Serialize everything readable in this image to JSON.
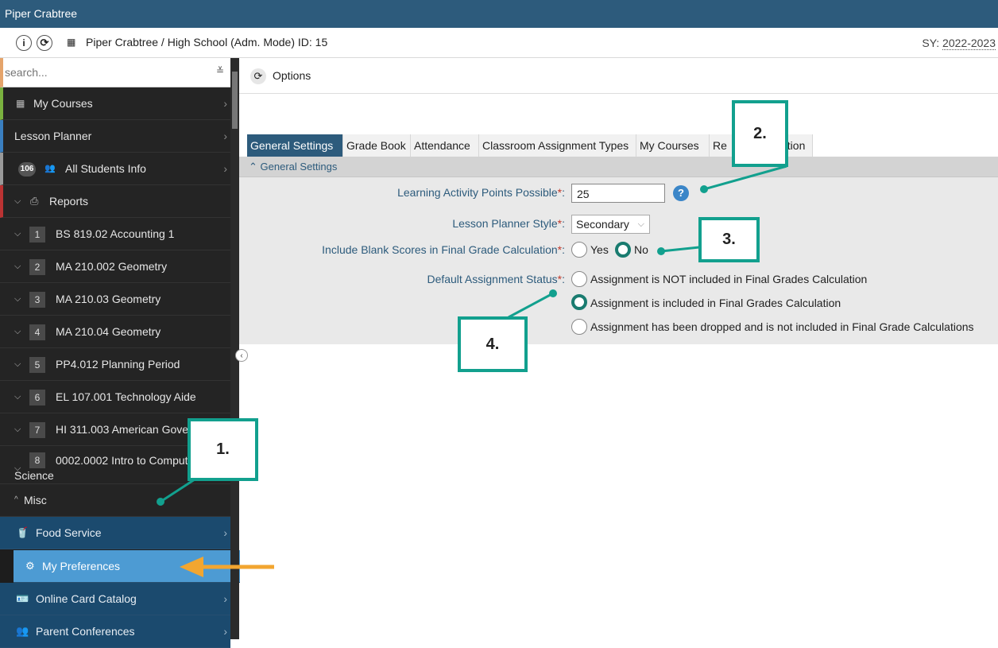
{
  "title_bar": {
    "user": "Piper Crabtree"
  },
  "info_bar": {
    "context": "Piper Crabtree / High School (Adm. Mode) ID: 15",
    "school_year_label": "SY:",
    "school_year": "2022-2023"
  },
  "sidebar": {
    "search_placeholder": "search...",
    "my_courses": "My Courses",
    "lesson_planner": "Lesson Planner",
    "students_count": "106",
    "all_students": "All Students Info",
    "reports": "Reports",
    "courses": [
      {
        "num": "1",
        "label": "BS 819.02 Accounting 1"
      },
      {
        "num": "2",
        "label": "MA 210.002 Geometry"
      },
      {
        "num": "3",
        "label": "MA 210.03 Geometry"
      },
      {
        "num": "4",
        "label": "MA 210.04 Geometry"
      },
      {
        "num": "5",
        "label": "PP4.012 Planning Period"
      },
      {
        "num": "6",
        "label": "EL 107.001 Technology Aide"
      },
      {
        "num": "7",
        "label": "HI 311.003 American Gove"
      },
      {
        "num": "8",
        "label": "0002.0002 Intro to Comput",
        "label2": "Science"
      }
    ],
    "misc": "Misc",
    "misc_items": [
      "Food Service",
      "My Preferences",
      "Online Card Catalog",
      "Parent Conferences"
    ]
  },
  "toolbar": {
    "options_label": "Options"
  },
  "tabs": [
    "General Settings",
    "Grade Book",
    "Attendance",
    "Classroom Assignment Types",
    "My Courses",
    "Re",
    "ation"
  ],
  "panel": {
    "header": "General Settings",
    "points_label": "Learning Activity Points Possible",
    "points_value": "25",
    "style_label": "Lesson Planner Style",
    "style_value": "Secondary",
    "blank_label": "Include Blank Scores in Final Grade Calculation",
    "yes": "Yes",
    "no": "No",
    "status_label": "Default Assignment Status",
    "status_options": [
      "Assignment is NOT included in Final Grades Calculation",
      "Assignment is included in Final Grades Calculation",
      "Assignment has been dropped and is not included in Final Grade Calculations"
    ]
  },
  "callouts": [
    "1.",
    "2.",
    "3.",
    "4."
  ],
  "colors": {
    "accent": "#2d5b7c",
    "callout": "#12a08e",
    "arrow": "#f2a630",
    "active": "#4d9bd3"
  }
}
